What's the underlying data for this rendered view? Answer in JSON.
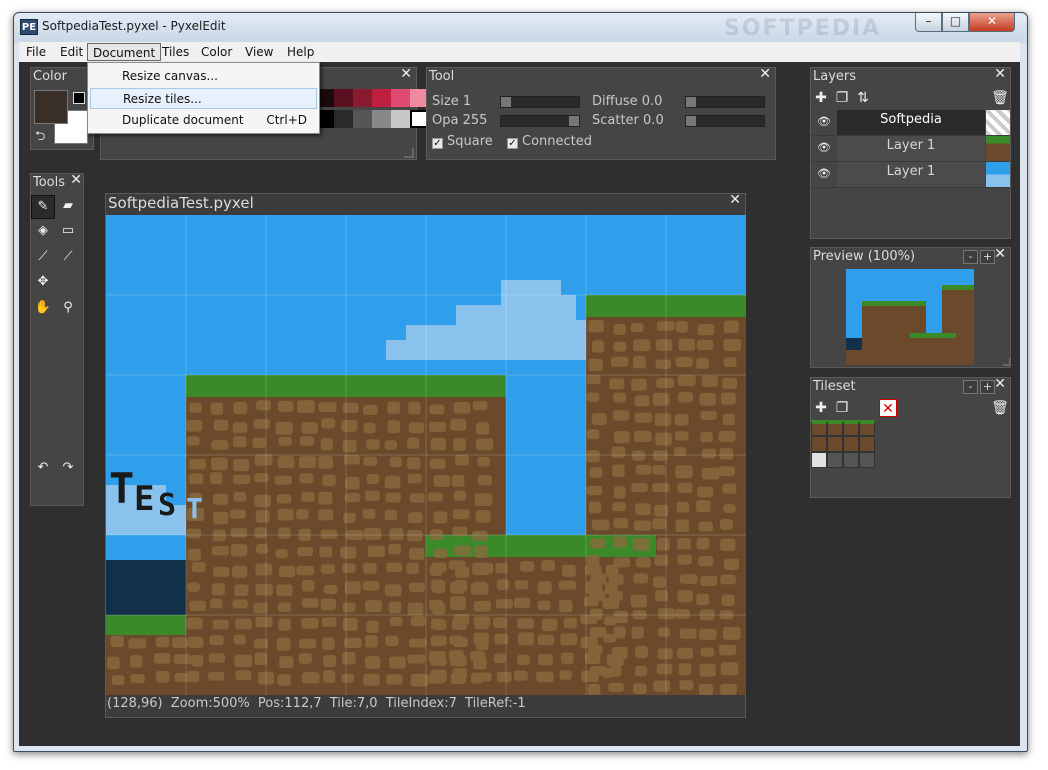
{
  "window": {
    "title": "SoftpediaTest.pyxel - PyxelEdit",
    "app_icon": "PE"
  },
  "menu": [
    "File",
    "Edit",
    "Document",
    "Tiles",
    "Color",
    "View",
    "Help"
  ],
  "document_menu": [
    {
      "label": "Resize canvas...",
      "shortcut": ""
    },
    {
      "label": "Resize tiles...",
      "shortcut": ""
    },
    {
      "label": "Duplicate document",
      "shortcut": "Ctrl+D"
    }
  ],
  "panels": {
    "color": {
      "title": "Color",
      "primary": "#3a2e29",
      "secondary": "#ffffff"
    },
    "palette": {
      "row1": [
        "#1a0a0a",
        "#5a1020",
        "#8a1a30",
        "#c02040",
        "#e04a70",
        "#f08aa0"
      ],
      "row2": [
        "#000000",
        "#2a2a2a",
        "#555555",
        "#888888",
        "#c8c8c8",
        "#ffffff"
      ]
    },
    "tool": {
      "title": "Tool",
      "size": "Size 1",
      "opa": "Opa 255",
      "diffuse": "Diffuse 0.0",
      "scatter": "Scatter 0.0",
      "square": "Square",
      "connected": "Connected",
      "square_checked": true,
      "connected_checked": true
    },
    "tools": {
      "title": "Tools"
    },
    "canvas": {
      "title": "SoftpediaTest.pyxel",
      "status": "(128,96)  Zoom:500%  Pos:112,7  Tile:7,0  TileIndex:7  TileRef:-1",
      "text_art": "TEST"
    },
    "layers": {
      "title": "Layers",
      "items": [
        "Softpedia",
        "Layer 1",
        "Layer 1"
      ]
    },
    "preview": {
      "title": "Preview (100%)"
    },
    "tileset": {
      "title": "Tileset"
    }
  },
  "watermark": "SOFTPEDIA",
  "colors": {
    "bg": "#2f2f2f",
    "panel": "#454545",
    "sky": "#2f9fec",
    "cloud": "#8ac2ee",
    "dirt": "#6a4a2a",
    "grass": "#3a8a2a",
    "water": "#123049"
  }
}
